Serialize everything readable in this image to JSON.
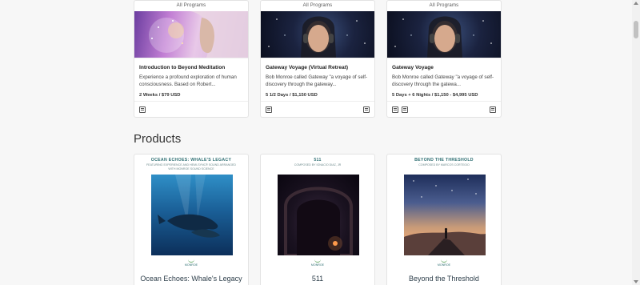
{
  "programs": [
    {
      "category": "All Programs",
      "title": "Introduction to Beyond Meditation",
      "description": "Experience a profound exploration of human consciousness. Based on Robert...",
      "price": "2 Weeks / $79 USD",
      "image_icon": "meditation-woman-cosmos",
      "footer_icons": [
        "video-course-icon"
      ]
    },
    {
      "category": "All Programs",
      "title": "Gateway Voyage (Virtual Retreat)",
      "description": "Bob Monroe called Gateway \"a voyage of self-discovery through the gateway...",
      "price": "5 1/2 Days / $1,150 USD",
      "image_icon": "woman-headphones-space",
      "footer_icons": [
        "calendar-icon",
        "video-call-icon"
      ]
    },
    {
      "category": "All Programs",
      "title": "Gateway Voyage",
      "description": " Bob Monroe called Gateway \"a voyage of self-discovery through the gatewa...",
      "price": "5 Days + 6 Nights / $1,150 - $4,995 USD",
      "image_icon": "woman-headphones-space",
      "footer_icons": [
        "bed-icon",
        "calendar-icon",
        "video-call-icon"
      ]
    }
  ],
  "products_heading": "Products",
  "products": [
    {
      "art_title": "OCEAN ECHOES: WHALE'S LEGACY",
      "art_subtitle": "FEATURING EXPERIENCE AND HEMI-SYNC® SOUND ARRANGED WITH MONROE SOUND SCIENCE",
      "art_image": "whales-underwater",
      "brand": "MONROE",
      "name": "Ocean Echoes: Whale's Legacy"
    },
    {
      "art_title": "511",
      "art_subtitle": "COMPOSED BY IGNACIO DIAZ, JR",
      "art_image": "stone-tunnel",
      "brand": "MONROE",
      "name": "511"
    },
    {
      "art_title": "BEYOND THE THRESHOLD",
      "art_subtitle": "COMPOSED BY MARCOS CORTEGIO",
      "art_image": "figure-on-mountain-starry-sky",
      "brand": "MONROE",
      "name": "Beyond the Threshold"
    }
  ],
  "colors": {
    "accent_teal": "#2f6f73",
    "product_name": "#2d3e4a",
    "page_bg": "#f7f7f7"
  }
}
